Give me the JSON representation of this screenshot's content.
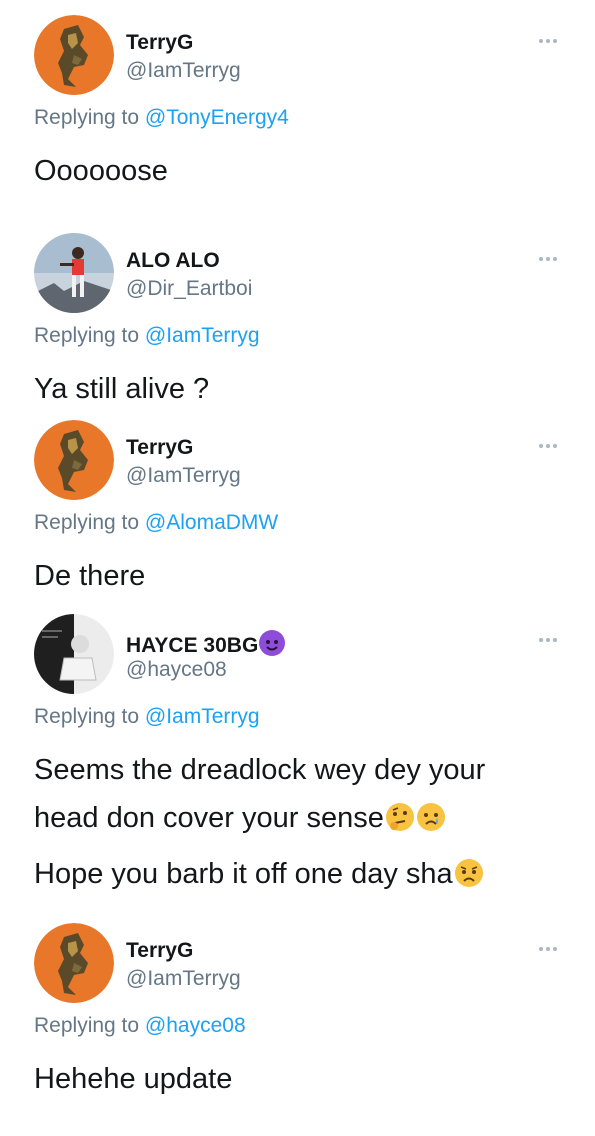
{
  "reply_prefix": "Replying to",
  "tweets": [
    {
      "name": "TerryG",
      "handle": "@IamTerryg",
      "reply_to": "@TonyEnergy4",
      "text": [
        "Oooooose"
      ]
    },
    {
      "name": "ALO ALO",
      "handle": "@Dir_Eartboi",
      "reply_to": "@IamTerryg",
      "text": [
        "Ya still alive ?"
      ]
    },
    {
      "name": "TerryG",
      "handle": "@IamTerryg",
      "reply_to": "@AlomaDMW",
      "text": [
        "De there"
      ]
    },
    {
      "name": "HAYCE 30BG",
      "name_emoji": "smiling-devil-icon",
      "handle": "@hayce08",
      "reply_to": "@IamTerryg",
      "text": [
        "Seems the dreadlock wey dey your",
        "head don cover your sense",
        "Hope you barb it off one day sha"
      ],
      "text_emojis": [
        "thinking-face-icon",
        "crying-face-icon",
        "worried-face-icon"
      ]
    },
    {
      "name": "TerryG",
      "handle": "@IamTerryg",
      "reply_to": "@hayce08",
      "text": [
        "Hehehe update"
      ]
    }
  ],
  "colors": {
    "link": "#1da1f2",
    "secondary_text": "#657786",
    "primary_text": "#14171a",
    "terryg_avatar_bg": "#e8772a"
  }
}
